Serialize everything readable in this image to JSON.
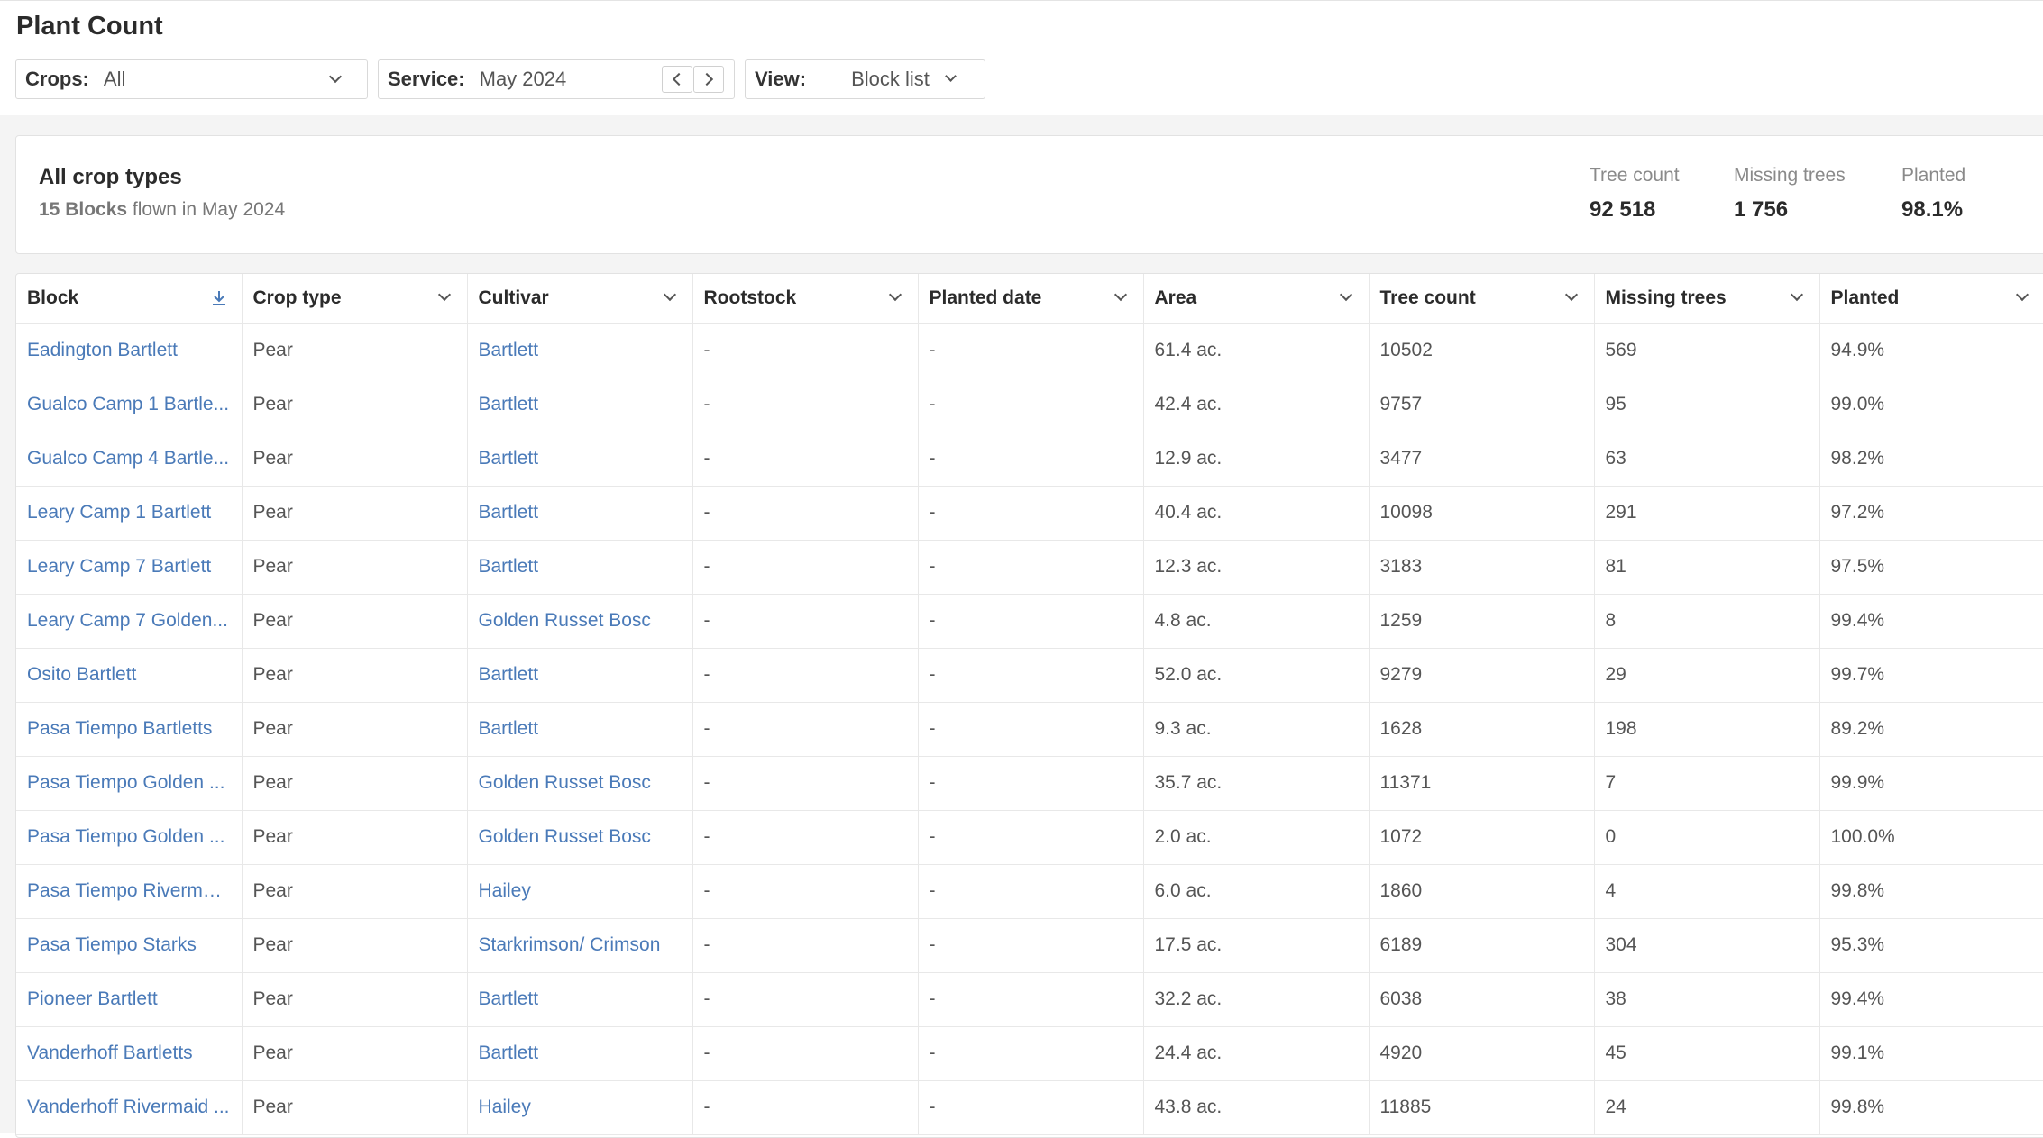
{
  "page": {
    "title": "Plant Count"
  },
  "filters": {
    "crops": {
      "label": "Crops:",
      "value": "All"
    },
    "service": {
      "label": "Service:",
      "value": "May 2024"
    },
    "view": {
      "label": "View:",
      "value": "Block list"
    }
  },
  "summary": {
    "title": "All crop types",
    "blocks_count": "15 Blocks",
    "blocks_suffix": "flown in May 2024",
    "stats": [
      {
        "label": "Tree count",
        "value": "92 518"
      },
      {
        "label": "Missing trees",
        "value": "1 756"
      },
      {
        "label": "Planted",
        "value": "98.1%"
      }
    ]
  },
  "table": {
    "columns": [
      "Block",
      "Crop type",
      "Cultivar",
      "Rootstock",
      "Planted date",
      "Area",
      "Tree count",
      "Missing trees",
      "Planted"
    ],
    "rows": [
      [
        "Eadington Bartlett",
        "Pear",
        "Bartlett",
        "-",
        "-",
        "61.4 ac.",
        "10502",
        "569",
        "94.9%"
      ],
      [
        "Gualco Camp 1 Bartle...",
        "Pear",
        "Bartlett",
        "-",
        "-",
        "42.4 ac.",
        "9757",
        "95",
        "99.0%"
      ],
      [
        "Gualco Camp 4 Bartle...",
        "Pear",
        "Bartlett",
        "-",
        "-",
        "12.9 ac.",
        "3477",
        "63",
        "98.2%"
      ],
      [
        "Leary Camp 1 Bartlett",
        "Pear",
        "Bartlett",
        "-",
        "-",
        "40.4 ac.",
        "10098",
        "291",
        "97.2%"
      ],
      [
        "Leary Camp 7 Bartlett",
        "Pear",
        "Bartlett",
        "-",
        "-",
        "12.3 ac.",
        "3183",
        "81",
        "97.5%"
      ],
      [
        "Leary Camp 7 Golden...",
        "Pear",
        "Golden Russet Bosc",
        "-",
        "-",
        "4.8 ac.",
        "1259",
        "8",
        "99.4%"
      ],
      [
        "Osito Bartlett",
        "Pear",
        "Bartlett",
        "-",
        "-",
        "52.0 ac.",
        "9279",
        "29",
        "99.7%"
      ],
      [
        "Pasa Tiempo Bartletts",
        "Pear",
        "Bartlett",
        "-",
        "-",
        "9.3 ac.",
        "1628",
        "198",
        "89.2%"
      ],
      [
        "Pasa Tiempo Golden ...",
        "Pear",
        "Golden Russet Bosc",
        "-",
        "-",
        "35.7 ac.",
        "11371",
        "7",
        "99.9%"
      ],
      [
        "Pasa Tiempo Golden ...",
        "Pear",
        "Golden Russet Bosc",
        "-",
        "-",
        "2.0 ac.",
        "1072",
        "0",
        "100.0%"
      ],
      [
        "Pasa Tiempo Rivermai...",
        "Pear",
        "Hailey",
        "-",
        "-",
        "6.0 ac.",
        "1860",
        "4",
        "99.8%"
      ],
      [
        "Pasa Tiempo Starks",
        "Pear",
        "Starkrimson/ Crimson",
        "-",
        "-",
        "17.5 ac.",
        "6189",
        "304",
        "95.3%"
      ],
      [
        "Pioneer Bartlett",
        "Pear",
        "Bartlett",
        "-",
        "-",
        "32.2 ac.",
        "6038",
        "38",
        "99.4%"
      ],
      [
        "Vanderhoff Bartletts",
        "Pear",
        "Bartlett",
        "-",
        "-",
        "24.4 ac.",
        "4920",
        "45",
        "99.1%"
      ],
      [
        "Vanderhoff Rivermaid ...",
        "Pear",
        "Hailey",
        "-",
        "-",
        "43.8 ac.",
        "11885",
        "24",
        "99.8%"
      ]
    ]
  }
}
